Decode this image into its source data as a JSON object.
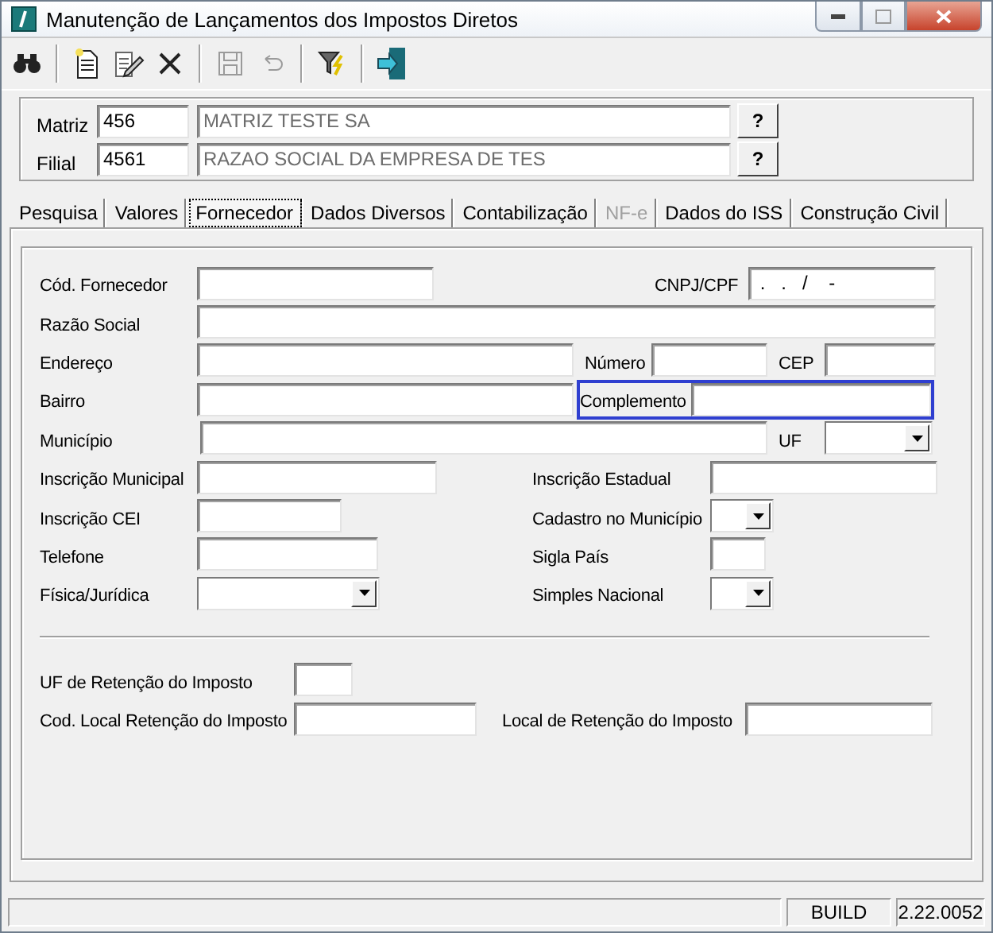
{
  "window": {
    "title": "Manutenção de Lançamentos dos Impostos Diretos"
  },
  "toolbar": [
    {
      "kind": "find",
      "disabled": false
    },
    {
      "kind": "separator"
    },
    {
      "kind": "new",
      "disabled": false
    },
    {
      "kind": "edit",
      "disabled": false
    },
    {
      "kind": "delete",
      "disabled": false
    },
    {
      "kind": "separator"
    },
    {
      "kind": "save",
      "disabled": true
    },
    {
      "kind": "undo",
      "disabled": true
    },
    {
      "kind": "separator"
    },
    {
      "kind": "filter",
      "disabled": false
    },
    {
      "kind": "separator"
    },
    {
      "kind": "exit",
      "disabled": false
    }
  ],
  "header": [
    {
      "label": "Matriz",
      "code": "456",
      "name": "MATRIZ TESTE SA",
      "button": "?"
    },
    {
      "label": "Filial",
      "code": "4561",
      "name": "RAZAO SOCIAL DA EMPRESA DE TES",
      "button": "?"
    }
  ],
  "tabs": [
    {
      "label": "Pesquisa",
      "selected": false,
      "disabled": false
    },
    {
      "label": "Valores",
      "selected": false,
      "disabled": false
    },
    {
      "label": "Fornecedor",
      "selected": true,
      "disabled": false
    },
    {
      "label": "Dados Diversos",
      "selected": false,
      "disabled": false
    },
    {
      "label": "Contabilização",
      "selected": false,
      "disabled": false
    },
    {
      "label": "NF-e",
      "selected": false,
      "disabled": true
    },
    {
      "label": "Dados do ISS",
      "selected": false,
      "disabled": false
    },
    {
      "label": "Construção Civil",
      "selected": false,
      "disabled": false
    }
  ],
  "rows": [
    [
      {
        "label": "Cód. Fornecedor",
        "kind": "text",
        "focused": false
      },
      {
        "label": "CNPJ/CPF",
        "kind": "text",
        "value": " .   .   /    -",
        "focused": false
      }
    ],
    [
      {
        "label": "Razão Social",
        "kind": "text",
        "focused": false
      }
    ],
    [
      {
        "label": "Endereço",
        "kind": "text",
        "focused": false
      },
      {
        "label": "Número",
        "kind": "text",
        "focused": false
      },
      {
        "label": "CEP",
        "kind": "text",
        "focused": false
      }
    ],
    [
      {
        "label": "Bairro",
        "kind": "text",
        "focused": false
      },
      {
        "label": "Complemento",
        "kind": "text",
        "focused": true
      }
    ],
    [
      {
        "label": "Município",
        "kind": "text",
        "focused": false
      },
      {
        "label": "UF",
        "kind": "combo",
        "focused": false
      }
    ],
    [
      {
        "label": "Inscrição Municipal",
        "kind": "text",
        "focused": false
      },
      {
        "label": "Inscrição Estadual",
        "kind": "text",
        "focused": false
      }
    ],
    [
      {
        "label": "Inscrição CEI",
        "kind": "text",
        "focused": false
      },
      {
        "label": "Cadastro no Município",
        "kind": "combo",
        "focused": false
      }
    ],
    [
      {
        "label": "Telefone",
        "kind": "text",
        "focused": false
      },
      {
        "label": "Sigla País",
        "kind": "text",
        "focused": false
      }
    ],
    [
      {
        "label": "Física/Jurídica",
        "kind": "combo",
        "focused": false
      },
      {
        "label": "Simples Nacional",
        "kind": "combo",
        "focused": false
      }
    ],
    [
      {
        "label": "UF de Retenção do Imposto",
        "kind": "text",
        "focused": false
      }
    ],
    [
      {
        "label": "Cod. Local Retenção do Imposto",
        "kind": "text",
        "focused": false
      },
      {
        "label": "Local de Retenção do Imposto",
        "kind": "text",
        "focused": false
      }
    ]
  ],
  "status_bar": [
    "BUILD",
    "2.22.0052"
  ]
}
